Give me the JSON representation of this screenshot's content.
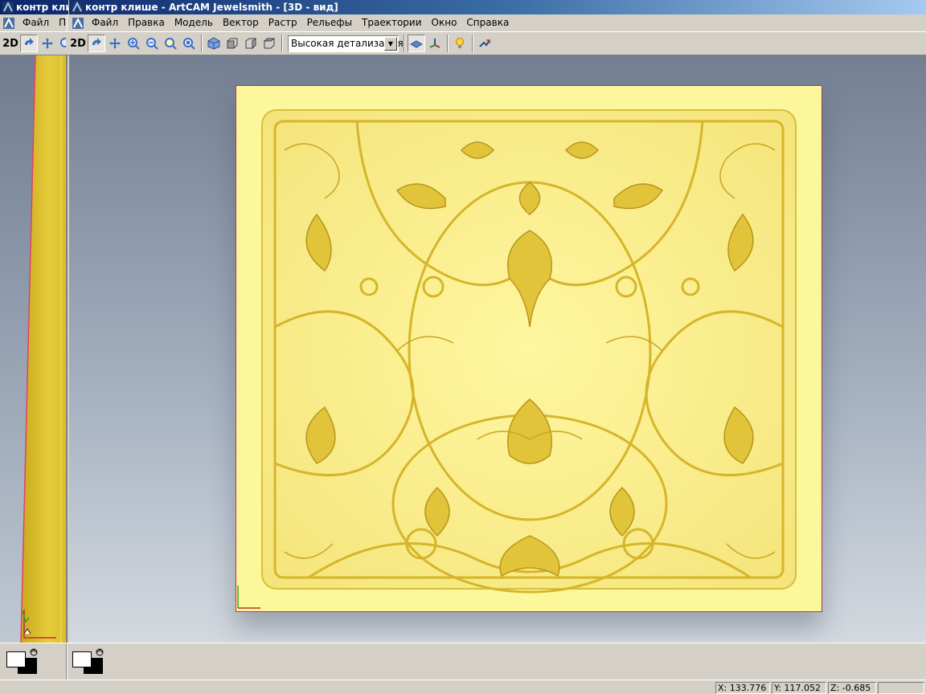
{
  "window": {
    "title_left": "контр клиш",
    "title_main": "контр клише - ArtCAM Jewelsmith - [3D - вид]"
  },
  "menubar": {
    "left_items": [
      "Файл",
      "Пра"
    ],
    "items": [
      "Файл",
      "Правка",
      "Модель",
      "Вектор",
      "Растр",
      "Рельефы",
      "Траектории",
      "Окно",
      "Справка"
    ]
  },
  "toolbar": {
    "mode_label_left": "2D",
    "mode_label": "2D",
    "detail_select": "Высокая детализация",
    "icons": [
      "rotate-icon",
      "pan-icon",
      "zoom-in-icon",
      "zoom-out-icon",
      "zoom-fit-icon",
      "zoom-box-icon",
      "iso-view-icon",
      "front-view-icon",
      "side-view-icon",
      "top-view-icon",
      "render-plane-icon",
      "axes-icon",
      "light-bulb-icon",
      "toolpath-icon"
    ]
  },
  "colors": {
    "relief": "#fdf79b",
    "relief_line": "#d6b52a",
    "border": "#c0305a",
    "bg_top": "#747f92",
    "bg_bottom": "#d4d9df"
  },
  "status": {
    "x": "X: 133.776",
    "y": "Y: 117.052",
    "z": "Z: -0.685"
  }
}
